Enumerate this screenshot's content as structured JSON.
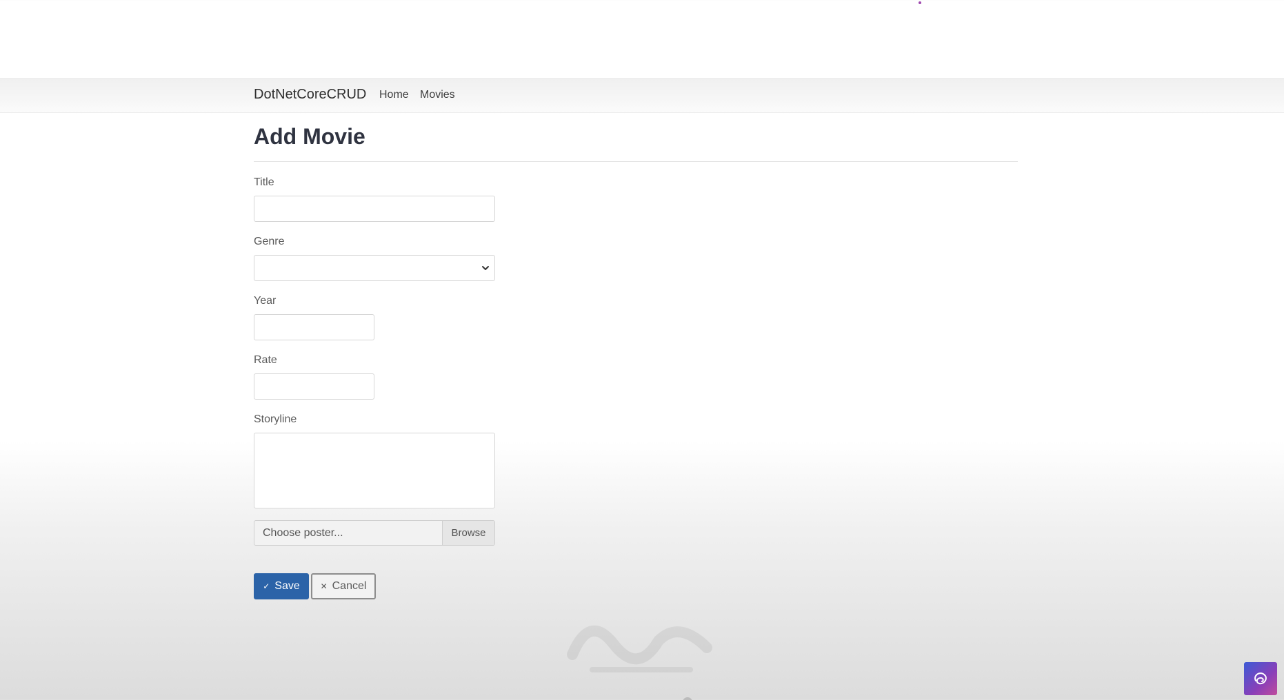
{
  "navbar": {
    "brand": "DotNetCoreCRUD",
    "links": [
      {
        "label": "Home"
      },
      {
        "label": "Movies"
      }
    ]
  },
  "page": {
    "title": "Add Movie"
  },
  "form": {
    "title": {
      "label": "Title",
      "value": ""
    },
    "genre": {
      "label": "Genre",
      "selected": ""
    },
    "year": {
      "label": "Year",
      "value": ""
    },
    "rate": {
      "label": "Rate",
      "value": ""
    },
    "storyline": {
      "label": "Storyline",
      "value": ""
    },
    "poster": {
      "placeholder": "Choose poster...",
      "browse_label": "Browse"
    },
    "save_label": "Save",
    "cancel_label": "Cancel"
  },
  "colors": {
    "primary": "#2b63a8",
    "badge_gradient_start": "#3c5bd6",
    "badge_gradient_end": "#c04c9c"
  },
  "icons": {
    "save": "check-icon",
    "cancel": "close-icon",
    "genre_dropdown": "chevron-down-icon"
  }
}
